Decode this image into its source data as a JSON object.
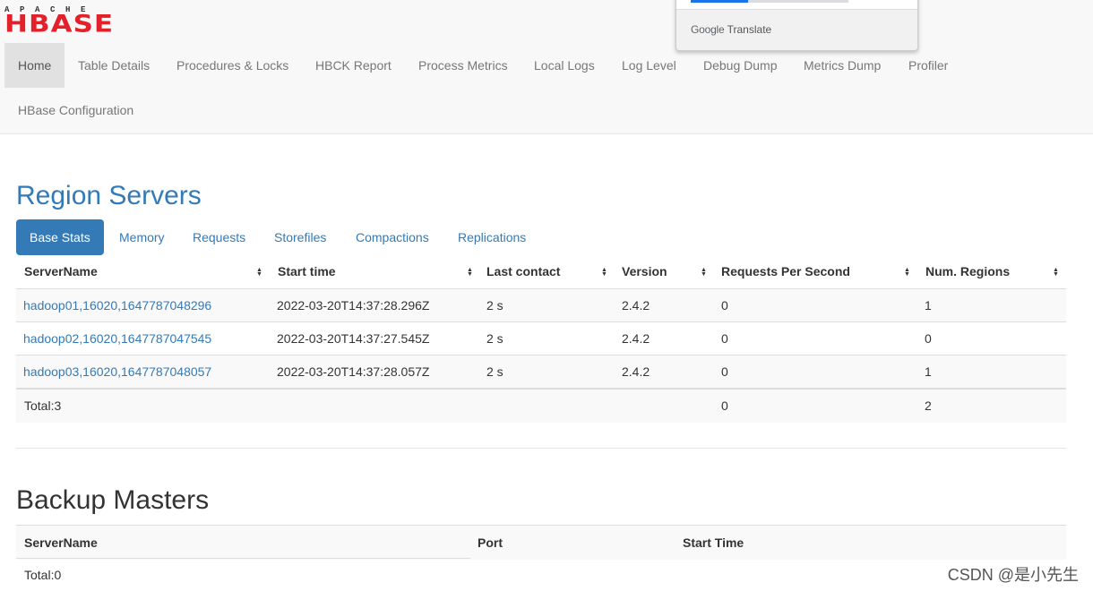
{
  "logo": {
    "top_text": "APACHE",
    "main_text": "HBASE"
  },
  "nav": {
    "items": [
      "Home",
      "Table Details",
      "Procedures & Locks",
      "HBCK Report",
      "Process Metrics",
      "Local Logs",
      "Log Level",
      "Debug Dump",
      "Metrics Dump",
      "Profiler",
      "HBase Configuration"
    ],
    "active": "Home"
  },
  "translate_popup": {
    "google": "Google",
    "translate": "Translate"
  },
  "region_servers": {
    "title": "Region Servers",
    "tabs": [
      "Base Stats",
      "Memory",
      "Requests",
      "Storefiles",
      "Compactions",
      "Replications"
    ],
    "active_tab": "Base Stats",
    "columns": [
      "ServerName",
      "Start time",
      "Last contact",
      "Version",
      "Requests Per Second",
      "Num. Regions"
    ],
    "sort_icon": "sort-both-icon",
    "rows": [
      [
        "hadoop01,16020,1647787048296",
        "2022-03-20T14:37:28.296Z",
        "2 s",
        "2.4.2",
        "0",
        "1"
      ],
      [
        "hadoop02,16020,1647787047545",
        "2022-03-20T14:37:27.545Z",
        "2 s",
        "2.4.2",
        "0",
        "0"
      ],
      [
        "hadoop03,16020,1647787048057",
        "2022-03-20T14:37:28.057Z",
        "2 s",
        "2.4.2",
        "0",
        "1"
      ]
    ],
    "total": {
      "label": "Total:3",
      "requests": "0",
      "regions": "2"
    }
  },
  "backup_masters": {
    "title": "Backup Masters",
    "columns": [
      "ServerName",
      "Port",
      "Start Time"
    ],
    "total": "Total:0"
  },
  "watermark": "CSDN @是小先生",
  "colors": {
    "link": "#337ab7",
    "brand_red": "#e3212b",
    "active_tab_bg": "#337ab7"
  }
}
